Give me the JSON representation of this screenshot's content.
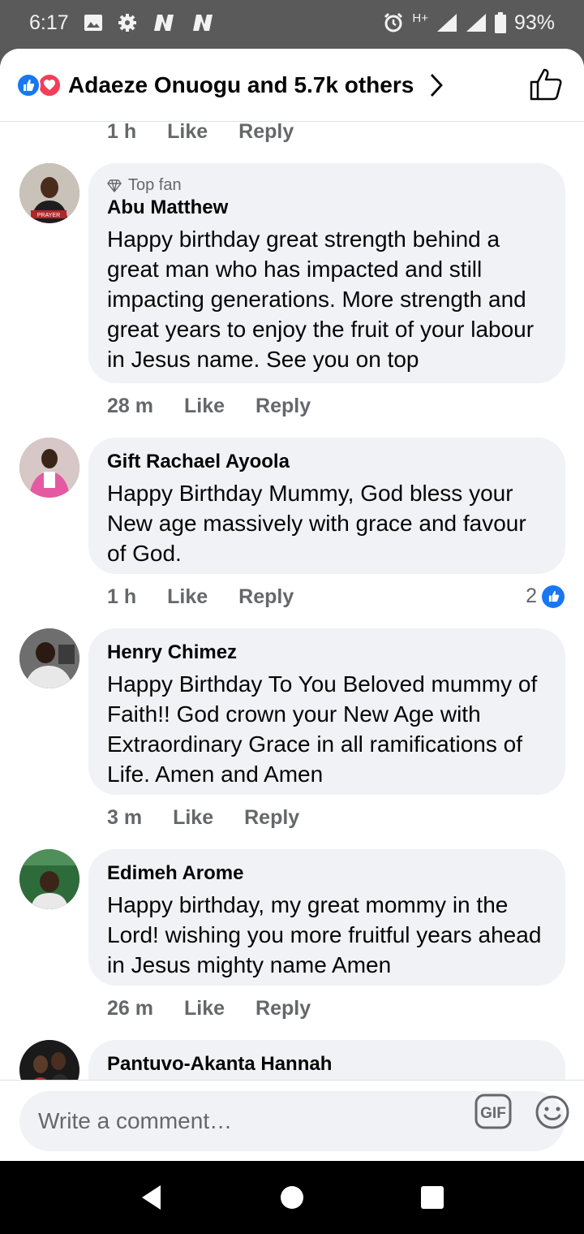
{
  "status_bar": {
    "time": "6:17",
    "network": "H+",
    "battery": "93%",
    "icons": [
      "image-icon",
      "gear-icon",
      "n-icon",
      "n-icon",
      "alarm-icon",
      "signal-icon",
      "signal-icon",
      "battery-icon"
    ]
  },
  "header": {
    "reactions_text": "Adaeze Onuogu and 5.7k others",
    "reaction_icons": [
      "like-icon",
      "love-icon"
    ],
    "accent_like": "#1877f2",
    "accent_love": "#f33e58"
  },
  "top_meta": {
    "time": "1 h",
    "like": "Like",
    "reply": "Reply"
  },
  "comments": [
    {
      "badge": "Top fan",
      "author": "Abu Matthew",
      "text": "Happy birthday great strength behind a great man who has impacted and still impacting generations. More strength and great years to enjoy the fruit of your labour in Jesus name. See you on top",
      "time": "28 m",
      "like": "Like",
      "reply": "Reply"
    },
    {
      "author": "Gift Rachael Ayoola",
      "text": "Happy Birthday Mummy, God bless your New age massively with grace and favour of God.",
      "time": "1 h",
      "like": "Like",
      "reply": "Reply",
      "likes": "2"
    },
    {
      "author": "Henry Chimez",
      "text": "Happy Birthday To You Beloved mummy of Faith!! God crown your New Age with Extraordinary Grace in all ramifications of Life. Amen and Amen",
      "time": "3 m",
      "like": "Like",
      "reply": "Reply"
    },
    {
      "author": "Edimeh Arome",
      "text": "Happy birthday, my great mommy in the Lord! wishing you more fruitful years ahead in Jesus mighty name Amen",
      "time": "26 m",
      "like": "Like",
      "reply": "Reply"
    },
    {
      "author": "Pantuvo-Akanta Hannah"
    }
  ],
  "composer": {
    "placeholder": "Write a comment…",
    "gif_label": "GIF"
  },
  "nav": [
    "back-icon",
    "home-icon",
    "recents-icon"
  ]
}
